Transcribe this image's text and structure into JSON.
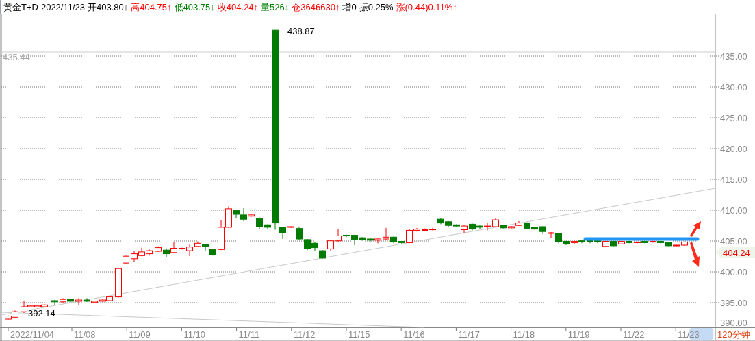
{
  "header": {
    "instrument": "黄金T+D",
    "date": "2022/11/23",
    "quotes": [
      {
        "label": "开",
        "value": "403.80",
        "arrow": "↓",
        "color": "#000000"
      },
      {
        "label": "高",
        "value": "404.75",
        "arrow": "↑",
        "color": "#ff0000"
      },
      {
        "label": "低",
        "value": "403.75",
        "arrow": "↓",
        "color": "#008000"
      },
      {
        "label": "收",
        "value": "404.24",
        "arrow": "↑",
        "color": "#ff0000"
      },
      {
        "label": "量",
        "value": "526",
        "arrow": "↓",
        "color": "#008000"
      },
      {
        "label": "仓",
        "value": "3646630",
        "arrow": "↑",
        "color": "#ff0000"
      },
      {
        "label": "增",
        "value": "0",
        "color": "#000000"
      },
      {
        "label": "振",
        "value": "0.25%",
        "color": "#000000"
      },
      {
        "label": "涨",
        "value": "(0.44)0.11%",
        "arrow": "↑",
        "color": "#ff0000"
      }
    ]
  },
  "chart": {
    "y_axis_labels": [
      "435.00",
      "430.00",
      "425.00",
      "420.00",
      "415.00",
      "410.00",
      "405.00",
      "400.00",
      "395.00",
      "390.00"
    ],
    "x_axis_labels": [
      {
        "text": "2022/11/04",
        "selected": false
      },
      {
        "text": "11/08",
        "selected": false
      },
      {
        "text": "11/09",
        "selected": false
      },
      {
        "text": "11/10",
        "selected": false
      },
      {
        "text": "11/11",
        "selected": false
      },
      {
        "text": "11/12",
        "selected": false
      },
      {
        "text": "11/15",
        "selected": false
      },
      {
        "text": "11/16",
        "selected": false
      },
      {
        "text": "11/17",
        "selected": false
      },
      {
        "text": "11/18",
        "selected": false
      },
      {
        "text": "11/19",
        "selected": false
      },
      {
        "text": "11/22",
        "selected": false
      },
      {
        "text": "11/23",
        "selected": true
      }
    ],
    "high_label": "438.87",
    "low_label": "392.14",
    "reference_label": "435.44",
    "last_price": "404.24",
    "period": "120分钟"
  }
}
